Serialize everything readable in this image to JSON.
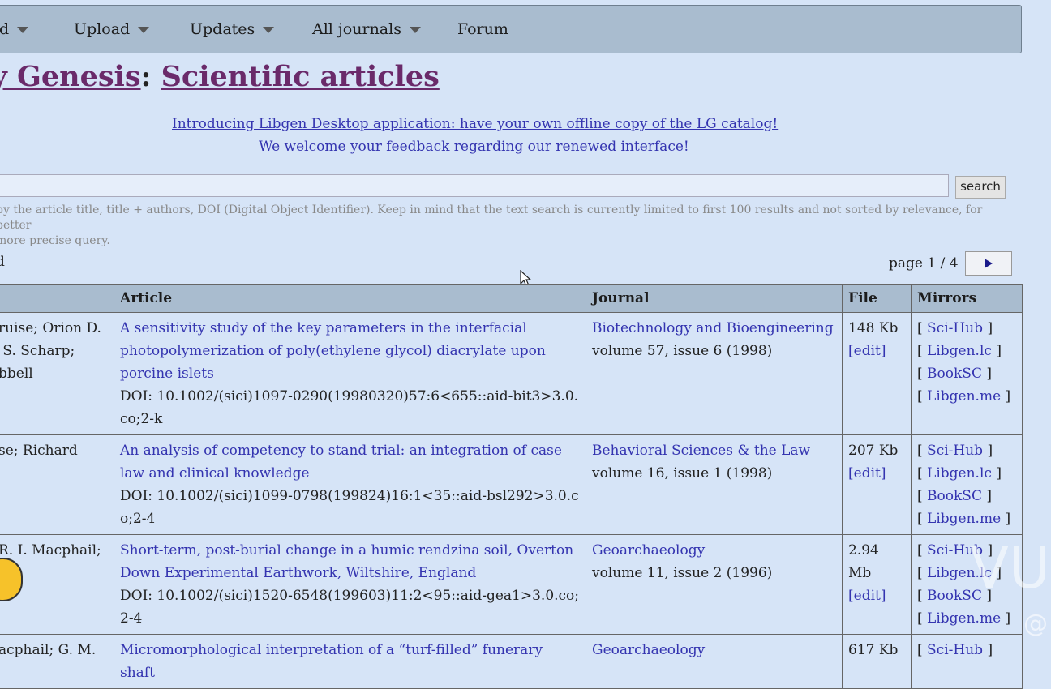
{
  "nav": {
    "items": [
      {
        "label": "d",
        "caret": true
      },
      {
        "label": "Upload",
        "caret": true
      },
      {
        "label": "Updates",
        "caret": true
      },
      {
        "label": "All journals",
        "caret": true
      },
      {
        "label": "Forum",
        "caret": false
      }
    ]
  },
  "title": {
    "part1": "ry Genesis",
    "separator": ":",
    "part2": "Scientific articles"
  },
  "announcements": [
    "Introducing Libgen Desktop application: have your own offline copy of the LG catalog!",
    "We welcome your feedback regarding our renewed interface!"
  ],
  "search": {
    "value": "",
    "button_label": "search",
    "hint": "by the article title, title + authors, DOI (Digital Object Identifier). Keep in mind that the text search is currently limited to first 100 results and not sorted by relevance, for better\n more precise query."
  },
  "results_found": "d",
  "pager": {
    "text": "page 1 / 4"
  },
  "table": {
    "headers": {
      "authors": "",
      "article": "Article",
      "journal": "Journal",
      "file": "File",
      "mirrors": "Mirrors"
    },
    "rows": [
      {
        "authors": "ruise; Orion D.\n S. Scharp;\nbbell",
        "title": "A sensitivity study of the key parameters in the interfacial photopolymerization of poly(ethylene glycol) diacrylate upon porcine islets",
        "doi": "DOI: 10.1002/(sici)1097-0290(19980320)57:6<655::aid-bit3>3.0.co;2-k",
        "journal": "Biotechnology and Bioengineering",
        "volume": "volume 57, issue 6 (1998)",
        "size": "148 Kb",
        "edit": "[edit]",
        "mirrors": [
          "Sci-Hub",
          "Libgen.lc",
          "BookSC",
          "Libgen.me"
        ]
      },
      {
        "authors": "se; Richard",
        "title": "An analysis of competency to stand trial: an integration of case law and clinical knowledge",
        "doi": "DOI: 10.1002/(sici)1099-0798(199824)16:1<35::aid-bsl292>3.0.co;2-4",
        "journal": "Behavioral Sciences & the Law",
        "volume": "volume 16, issue 1 (1998)",
        "size": "207 Kb",
        "edit": "[edit]",
        "mirrors": [
          "Sci-Hub",
          "Libgen.lc",
          "BookSC",
          "Libgen.me"
        ]
      },
      {
        "authors": "R. I. Macphail;",
        "title": "Short-term, post-burial change in a humic rendzina soil, Overton Down Experimental Earthwork, Wiltshire, England",
        "doi": "DOI: 10.1002/(sici)1520-6548(199603)11:2<95::aid-gea1>3.0.co;2-4",
        "journal": "Geoarchaeology",
        "volume": "volume 11, issue 2 (1996)",
        "size": "2.94 Mb",
        "edit": "[edit]",
        "mirrors": [
          "Sci-Hub",
          "Libgen.lc",
          "BookSC",
          "Libgen.me"
        ]
      },
      {
        "authors": "acphail; G. M.",
        "title": "Micromorphological interpretation of a “turf-filled” funerary shaft",
        "doi": "",
        "journal": "Geoarchaeology",
        "volume": "",
        "size": "617 Kb",
        "edit": "",
        "mirrors": [
          "Sci-Hub"
        ]
      }
    ]
  },
  "watermark": {
    "text": "VU",
    "handle": "@"
  },
  "colors": {
    "nav_bg": "#a9bccf",
    "page_bg": "#d6e4f7",
    "link": "#3434b0",
    "title": "#6a2a6a"
  }
}
